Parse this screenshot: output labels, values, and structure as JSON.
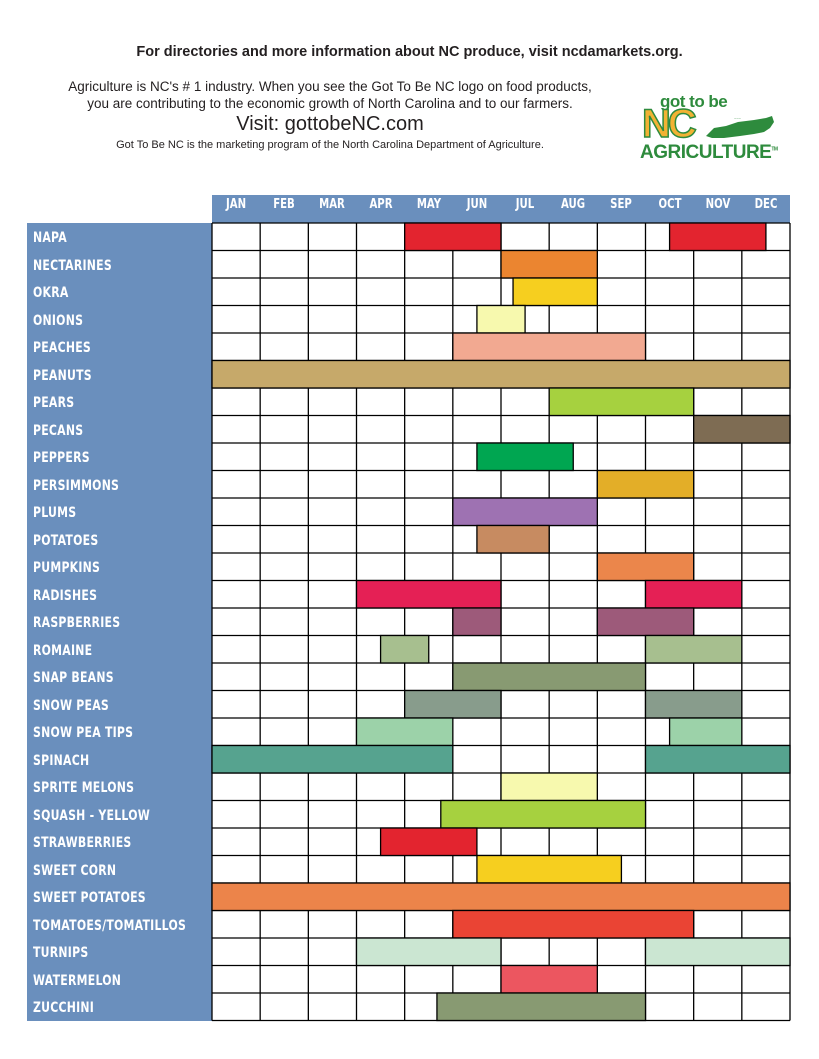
{
  "header": {
    "headline": "For directories and more information about NC produce, visit ncdamarkets.org.",
    "intro_line1": "Agriculture is NC's # 1 industry.  When you see the Got To Be NC logo on food products,",
    "intro_line2": "you are contributing to the economic growth of North Carolina and to our farmers.",
    "visit": "Visit: gottobeNC.com",
    "program": "Got To Be NC is the marketing program of the North Carolina Department of Agriculture."
  },
  "logo": {
    "top_text": "got to be",
    "middle_text": "NC",
    "bottom_text": "AGRICULTURE",
    "trademark": "TM",
    "icon": "nc-state-map-icon",
    "colors": {
      "green": "#2e8b3d",
      "gold": "#f2b233"
    }
  },
  "chart_data": {
    "type": "gantt",
    "title": "",
    "categories": [
      "JAN",
      "FEB",
      "MAR",
      "APR",
      "MAY",
      "JUN",
      "JUL",
      "AUG",
      "SEP",
      "OCT",
      "NOV",
      "DEC"
    ],
    "x_unit": "month (0 = start of January, 12 = end of December)",
    "xlim": [
      0,
      12
    ],
    "grid": true,
    "colors": {
      "header": "#6a8fbd",
      "label_panel": "#6a8fbd",
      "grid_line": "#000000"
    },
    "rows": [
      {
        "name": "NAPA",
        "color": "#e3242f",
        "ranges": [
          [
            4,
            6
          ],
          [
            9.5,
            11.5
          ]
        ]
      },
      {
        "name": "NECTARINES",
        "color": "#eb8530",
        "ranges": [
          [
            6,
            8
          ]
        ]
      },
      {
        "name": "OKRA",
        "color": "#f6cf1f",
        "ranges": [
          [
            6.25,
            8
          ]
        ]
      },
      {
        "name": "ONIONS",
        "color": "#f7f9ae",
        "ranges": [
          [
            5.5,
            6.5
          ]
        ]
      },
      {
        "name": "PEACHES",
        "color": "#f2a991",
        "ranges": [
          [
            5,
            9
          ]
        ]
      },
      {
        "name": "PEANUTS",
        "color": "#c6a96a",
        "ranges": [
          [
            0,
            12
          ]
        ]
      },
      {
        "name": "PEARS",
        "color": "#a6d13f",
        "ranges": [
          [
            7,
            10
          ]
        ]
      },
      {
        "name": "PECANS",
        "color": "#7e6c53",
        "ranges": [
          [
            10,
            12
          ]
        ]
      },
      {
        "name": "PEPPERS",
        "color": "#00a651",
        "ranges": [
          [
            5.5,
            7.5
          ]
        ]
      },
      {
        "name": "PERSIMMONS",
        "color": "#e3ae28",
        "ranges": [
          [
            8,
            10
          ]
        ]
      },
      {
        "name": "PLUMS",
        "color": "#9e72b2",
        "ranges": [
          [
            5,
            8
          ]
        ]
      },
      {
        "name": "POTATOES",
        "color": "#c78b61",
        "ranges": [
          [
            5.5,
            7
          ]
        ]
      },
      {
        "name": "PUMPKINS",
        "color": "#eb864b",
        "ranges": [
          [
            8,
            10
          ]
        ]
      },
      {
        "name": "RADISHES",
        "color": "#e52055",
        "ranges": [
          [
            3,
            6
          ],
          [
            9,
            11
          ]
        ]
      },
      {
        "name": "RASPBERRIES",
        "color": "#9d5a7a",
        "ranges": [
          [
            5,
            6
          ],
          [
            8,
            10
          ]
        ]
      },
      {
        "name": "ROMAINE",
        "color": "#a7bf8f",
        "ranges": [
          [
            3.5,
            4.5
          ],
          [
            9,
            11
          ]
        ]
      },
      {
        "name": "SNAP  BEANS",
        "color": "#889a72",
        "ranges": [
          [
            5,
            9
          ]
        ]
      },
      {
        "name": "SNOW  PEAS",
        "color": "#889c8c",
        "ranges": [
          [
            4,
            6
          ],
          [
            9,
            11
          ]
        ]
      },
      {
        "name": "SNOW  PEA  TIPS",
        "color": "#9cd2a9",
        "ranges": [
          [
            3,
            5
          ],
          [
            9.5,
            11
          ]
        ]
      },
      {
        "name": "SPINACH",
        "color": "#56a38f",
        "ranges": [
          [
            0,
            5
          ],
          [
            9,
            12
          ]
        ]
      },
      {
        "name": "SPRITE  MELONS",
        "color": "#f7f9ae",
        "ranges": [
          [
            6,
            8
          ]
        ]
      },
      {
        "name": "SQUASH  - YELLOW",
        "color": "#a6d13f",
        "ranges": [
          [
            4.75,
            9
          ]
        ]
      },
      {
        "name": "STRAWBERRIES",
        "color": "#e3242f",
        "ranges": [
          [
            3.5,
            5.5
          ]
        ]
      },
      {
        "name": "SWEET  CORN",
        "color": "#f6cf1f",
        "ranges": [
          [
            5.5,
            8.5
          ]
        ]
      },
      {
        "name": "SWEET  POTATOES",
        "color": "#ec844a",
        "ranges": [
          [
            0,
            12
          ]
        ]
      },
      {
        "name": "TOMATOES/TOMATILLOS",
        "color": "#ea4434",
        "ranges": [
          [
            5,
            10
          ]
        ]
      },
      {
        "name": "TURNIPS",
        "color": "#cbe6d2",
        "ranges": [
          [
            3,
            6
          ],
          [
            9,
            12
          ]
        ]
      },
      {
        "name": "WATERMELON",
        "color": "#ec5660",
        "ranges": [
          [
            6,
            8
          ]
        ]
      },
      {
        "name": "ZUCCHINI",
        "color": "#889a72",
        "ranges": [
          [
            4.67,
            9
          ]
        ]
      }
    ]
  }
}
